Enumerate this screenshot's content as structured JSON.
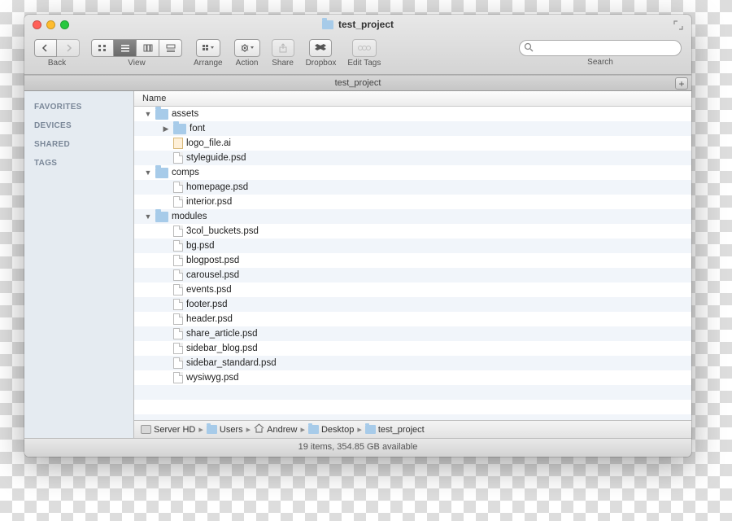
{
  "window": {
    "title": "test_project"
  },
  "toolbar": {
    "back_label": "Back",
    "view_label": "View",
    "arrange_label": "Arrange",
    "action_label": "Action",
    "share_label": "Share",
    "dropbox_label": "Dropbox",
    "edit_tags_label": "Edit Tags",
    "search_label": "Search",
    "search_placeholder": ""
  },
  "tab": {
    "label": "test_project"
  },
  "sidebar": {
    "categories": [
      "FAVORITES",
      "DEVICES",
      "SHARED",
      "TAGS"
    ]
  },
  "columns": {
    "name": "Name"
  },
  "tree": [
    {
      "name": "assets",
      "type": "folder",
      "level": 1,
      "expanded": true
    },
    {
      "name": "font",
      "type": "folder",
      "level": 2,
      "expanded": false
    },
    {
      "name": "logo_file.ai",
      "type": "ai",
      "level": 2
    },
    {
      "name": "styleguide.psd",
      "type": "file",
      "level": 2
    },
    {
      "name": "comps",
      "type": "folder",
      "level": 1,
      "expanded": true
    },
    {
      "name": "homepage.psd",
      "type": "file",
      "level": 2
    },
    {
      "name": "interior.psd",
      "type": "file",
      "level": 2
    },
    {
      "name": "modules",
      "type": "folder",
      "level": 1,
      "expanded": true
    },
    {
      "name": "3col_buckets.psd",
      "type": "file",
      "level": 2
    },
    {
      "name": "bg.psd",
      "type": "file",
      "level": 2
    },
    {
      "name": "blogpost.psd",
      "type": "file",
      "level": 2
    },
    {
      "name": "carousel.psd",
      "type": "file",
      "level": 2
    },
    {
      "name": "events.psd",
      "type": "file",
      "level": 2
    },
    {
      "name": "footer.psd",
      "type": "file",
      "level": 2
    },
    {
      "name": "header.psd",
      "type": "file",
      "level": 2
    },
    {
      "name": "share_article.psd",
      "type": "file",
      "level": 2
    },
    {
      "name": "sidebar_blog.psd",
      "type": "file",
      "level": 2
    },
    {
      "name": "sidebar_standard.psd",
      "type": "file",
      "level": 2
    },
    {
      "name": "wysiwyg.psd",
      "type": "file",
      "level": 2
    }
  ],
  "path": [
    {
      "label": "Server HD",
      "icon": "disk"
    },
    {
      "label": "Users",
      "icon": "folder"
    },
    {
      "label": "Andrew",
      "icon": "home"
    },
    {
      "label": "Desktop",
      "icon": "folder"
    },
    {
      "label": "test_project",
      "icon": "folder"
    }
  ],
  "status": "19 items, 354.85 GB available"
}
